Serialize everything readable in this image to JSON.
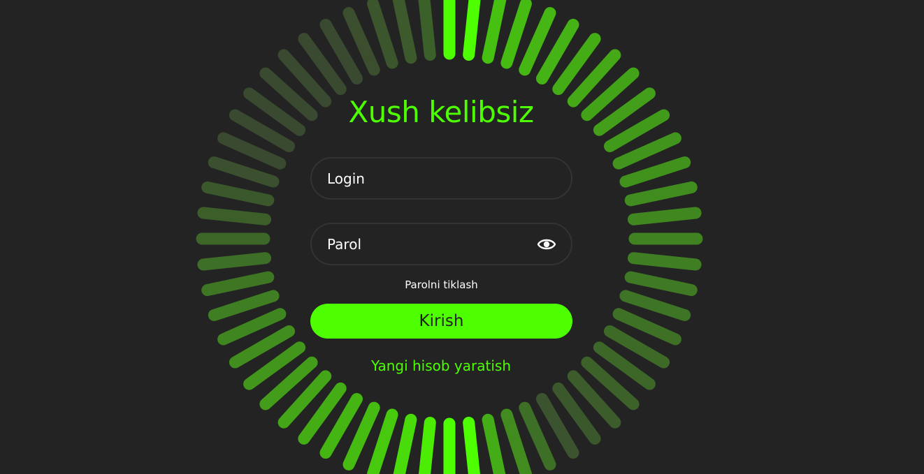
{
  "colors": {
    "background": "#232323",
    "accent": "#4dff00",
    "dim_segment": "#3a4a30",
    "field_border": "#333333",
    "text": "#ffffff"
  },
  "form": {
    "title": "Xush kelibsiz",
    "login_placeholder": "Login",
    "password_placeholder": "Parol",
    "reset_link": "Parolni tiklash",
    "submit_label": "Kirish",
    "create_account_link": "Yangi hisob yaratish"
  },
  "icons": {
    "password_toggle": "eye-icon"
  }
}
